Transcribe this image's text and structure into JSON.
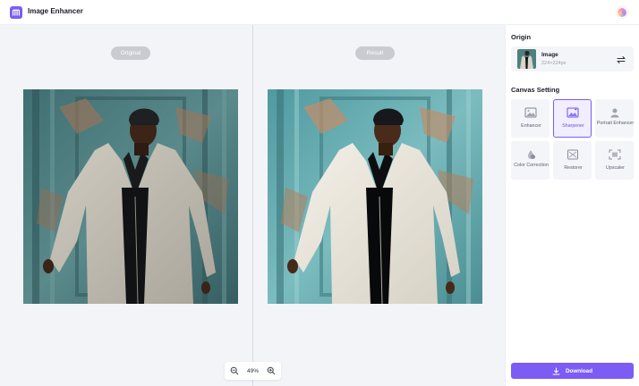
{
  "app": {
    "title": "Image Enhancer",
    "logo_icon": "m-logo-icon",
    "accent": "#7b5cf5"
  },
  "compare": {
    "original_label": "Original",
    "result_label": "Result",
    "zoom": "49%"
  },
  "origin": {
    "title": "Origin",
    "file_name": "Image",
    "file_size": "224×224px"
  },
  "canvas_setting": {
    "title": "Canvas Setting",
    "tools": [
      {
        "label": "Enhancer",
        "icon": "image-enhance-icon",
        "selected": false
      },
      {
        "label": "Sharpener",
        "icon": "sharpen-icon",
        "selected": true
      },
      {
        "label": "Portrait Enhancer",
        "icon": "portrait-icon",
        "selected": false
      },
      {
        "label": "Color Correction",
        "icon": "color-correction-icon",
        "selected": false
      },
      {
        "label": "Restorer",
        "icon": "restore-icon",
        "selected": false
      },
      {
        "label": "Upscaler",
        "icon": "upscale-icon",
        "selected": false
      }
    ]
  },
  "actions": {
    "download_label": "Download",
    "download_icon": "download-icon"
  }
}
